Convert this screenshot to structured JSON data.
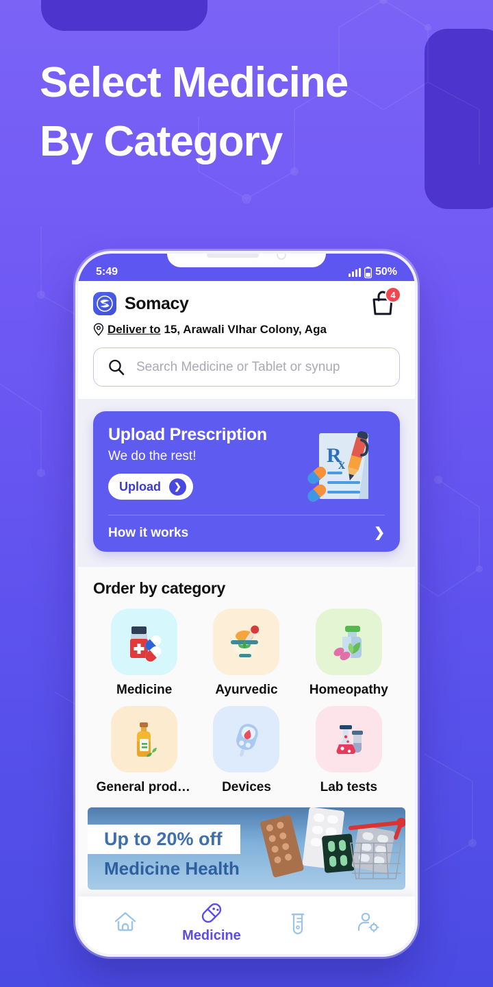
{
  "hero": {
    "line1": "Select Medicine",
    "line2": "By Category"
  },
  "colors": {
    "bg_top": "#7B63F6",
    "bg_bottom": "#4A4BE3",
    "shape_dark": "#4C34CC",
    "accent": "#5E5BF0",
    "badge_red": "#F1464F",
    "screen_bg": "#FAFAFB",
    "section_bg": "#EFEFF8"
  },
  "phone": {
    "status_bar": {
      "time": "5:49",
      "battery_text": "50%",
      "signal_icon": "signal-bars-icon",
      "battery_icon": "battery-icon"
    },
    "header": {
      "logo_icon": "somacy-logo-icon",
      "brand": "Somacy",
      "cart_icon": "shopping-bag-icon",
      "cart_count": "4",
      "location_icon": "location-pin-icon",
      "deliver_label": "Deliver to",
      "address": "15, Arawali VIhar Colony, Aga"
    },
    "search": {
      "icon": "search-icon",
      "placeholder": "Search Medicine or Tablet or synup",
      "value": ""
    },
    "prescription": {
      "title": "Upload Prescription",
      "subtitle": "We do the rest!",
      "upload_label": "Upload",
      "upload_arrow_icon": "chevron-right-circle-icon",
      "illustration_icon": "rx-prescription-pen-icon",
      "how_it_works_label": "How it works",
      "how_it_works_chevron": "chevron-right-icon"
    },
    "categories": {
      "heading": "Order by category",
      "items": [
        {
          "label": "Medicine",
          "icon": "medicine-bottle-pills-icon",
          "tile_color": "#D6F7FB"
        },
        {
          "label": "Ayurvedic",
          "icon": "mortar-pestle-herbs-icon",
          "tile_color": "#FDEFD7"
        },
        {
          "label": "Homeopathy",
          "icon": "herbal-bottle-leaf-icon",
          "tile_color": "#E4F5D4"
        },
        {
          "label": "General produ...",
          "icon": "oil-bottle-icon",
          "tile_color": "#FDEBCF"
        },
        {
          "label": "Devices",
          "icon": "glucometer-icon",
          "tile_color": "#DEEBFC"
        },
        {
          "label": "Lab tests",
          "icon": "lab-flask-tube-icon",
          "tile_color": "#FDE4EA"
        }
      ]
    },
    "promo": {
      "title": "Up to 20% off",
      "subtitle": "Medicine Health",
      "art_icon": "medicine-cart-photo"
    },
    "bottom_nav": {
      "items": [
        {
          "label": "",
          "icon": "home-icon",
          "active": false
        },
        {
          "label": "Medicine",
          "icon": "capsule-pill-icon",
          "active": true
        },
        {
          "label": "",
          "icon": "test-tube-icon",
          "active": false
        },
        {
          "label": "",
          "icon": "user-settings-icon",
          "active": false
        }
      ]
    }
  }
}
